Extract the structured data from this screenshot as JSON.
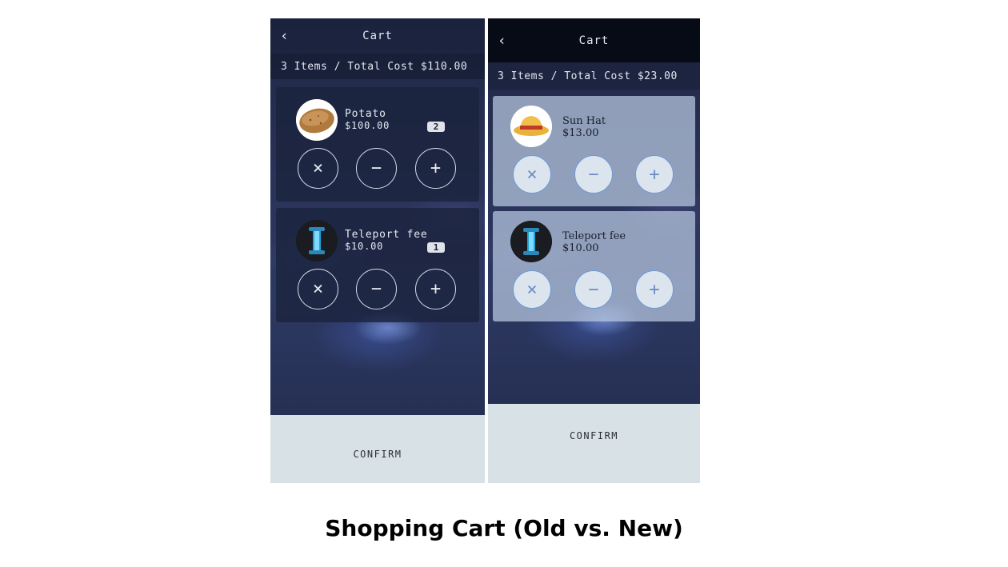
{
  "caption": "Shopping Cart (Old vs. New)",
  "old": {
    "title": "Cart",
    "back_icon": "chevron-left",
    "summary": "3 Items / Total Cost $110.00",
    "items": [
      {
        "name": "Potato",
        "price": "$100.00",
        "quantity": "2",
        "image": "potato"
      },
      {
        "name": "Teleport fee",
        "price": "$10.00",
        "quantity": "1",
        "image": "teleport-portal"
      }
    ],
    "confirm_label": "CONFIRM"
  },
  "new": {
    "title": "Cart",
    "back_icon": "chevron-left",
    "summary": "3 Items / Total Cost $23.00",
    "items": [
      {
        "name": "Sun Hat",
        "price": "$13.00",
        "image": "sun-hat"
      },
      {
        "name": "Teleport fee",
        "price": "$10.00",
        "image": "teleport-portal"
      }
    ],
    "confirm_label": "CONFIRM"
  },
  "icons": {
    "remove": "×",
    "decrease": "−",
    "increase": "+"
  },
  "colors": {
    "old_card": "#1b233d",
    "new_card": "#b4c4dc",
    "new_button_border": "#6d9ad6",
    "confirm_bar": "#d8e1e5"
  }
}
